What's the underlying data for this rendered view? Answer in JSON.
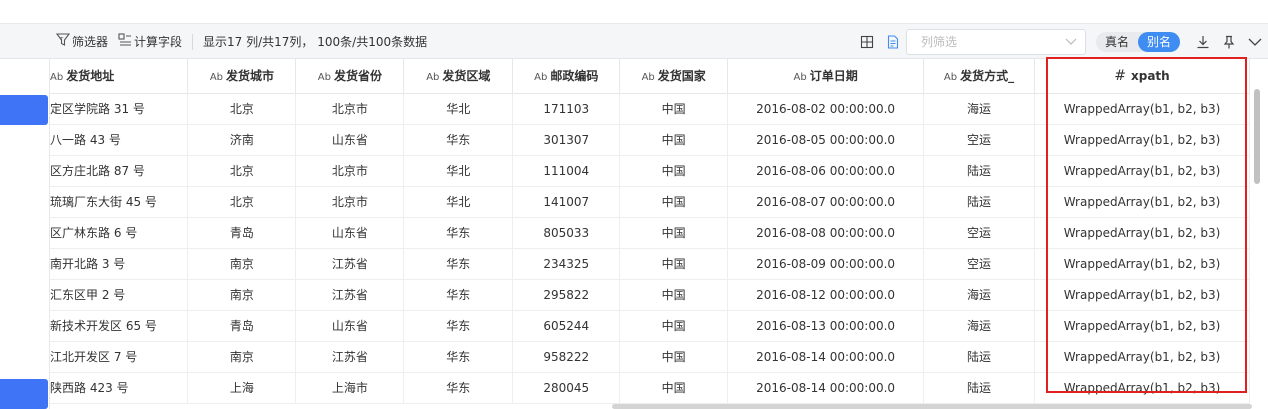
{
  "toolbar": {
    "filter_label": "筛选器",
    "calc_label": "计算字段",
    "info": "显示17 列/共17列， 100条/共100条数据",
    "column_filter_placeholder": "列筛选",
    "real_name": "真名",
    "alias": "别名",
    "alias_active": true,
    "accent_color": "#3f8cf3"
  },
  "table": {
    "columns": [
      {
        "label": "发货地址",
        "type": "Ab"
      },
      {
        "label": "发货城市",
        "type": "Ab"
      },
      {
        "label": "发货省份",
        "type": "Ab"
      },
      {
        "label": "发货区域",
        "type": "Ab"
      },
      {
        "label": "邮政编码",
        "type": "Ab"
      },
      {
        "label": "发货国家",
        "type": "Ab"
      },
      {
        "label": "订单日期",
        "type": "Ab"
      },
      {
        "label": "发货方式_",
        "type": "Ab"
      },
      {
        "label": "xpath",
        "type": "#"
      }
    ],
    "rows": [
      [
        "定区学院路 31 号",
        "北京",
        "北京市",
        "华北",
        "171103",
        "中国",
        "2016-08-02 00:00:00.0",
        "海运",
        "WrappedArray(b1, b2, b3)"
      ],
      [
        "八一路 43 号",
        "济南",
        "山东省",
        "华东",
        "301307",
        "中国",
        "2016-08-05 00:00:00.0",
        "空运",
        "WrappedArray(b1, b2, b3)"
      ],
      [
        "区方庄北路 87 号",
        "北京",
        "北京市",
        "华北",
        "111004",
        "中国",
        "2016-08-06 00:00:00.0",
        "陆运",
        "WrappedArray(b1, b2, b3)"
      ],
      [
        "琉璃厂东大街 45 号",
        "北京",
        "北京市",
        "华北",
        "141007",
        "中国",
        "2016-08-07 00:00:00.0",
        "陆运",
        "WrappedArray(b1, b2, b3)"
      ],
      [
        "区广林东路 6 号",
        "青岛",
        "山东省",
        "华东",
        "805033",
        "中国",
        "2016-08-08 00:00:00.0",
        "空运",
        "WrappedArray(b1, b2, b3)"
      ],
      [
        "南开北路 3 号",
        "南京",
        "江苏省",
        "华东",
        "234325",
        "中国",
        "2016-08-09 00:00:00.0",
        "空运",
        "WrappedArray(b1, b2, b3)"
      ],
      [
        "汇东区甲 2 号",
        "南京",
        "江苏省",
        "华东",
        "295822",
        "中国",
        "2016-08-12 00:00:00.0",
        "海运",
        "WrappedArray(b1, b2, b3)"
      ],
      [
        "新技术开发区 65 号",
        "青岛",
        "山东省",
        "华东",
        "605244",
        "中国",
        "2016-08-13 00:00:00.0",
        "海运",
        "WrappedArray(b1, b2, b3)"
      ],
      [
        "江北开发区 7 号",
        "南京",
        "江苏省",
        "华东",
        "958222",
        "中国",
        "2016-08-14 00:00:00.0",
        "陆运",
        "WrappedArray(b1, b2, b3)"
      ],
      [
        "陕西路 423 号",
        "上海",
        "上海市",
        "华东",
        "280045",
        "中国",
        "2016-08-14 00:00:00.0",
        "陆运",
        "WrappedArray(b1, b2, b3)"
      ]
    ]
  },
  "highlight_color": "#e12020"
}
